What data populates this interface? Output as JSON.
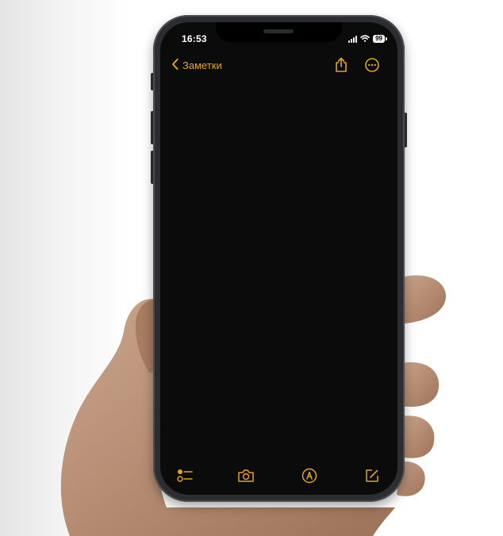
{
  "status_bar": {
    "time": "16:53",
    "battery": "99"
  },
  "navigation": {
    "back_label": "Заметки",
    "back_icon": "chevron-left-icon",
    "share_icon": "share-icon",
    "more_icon": "ellipsis-circle-icon"
  },
  "toolbar": {
    "icons": [
      "checklist-icon",
      "camera-icon",
      "markup-pen-icon",
      "compose-icon"
    ]
  },
  "colors": {
    "accent": "#e3a51c",
    "screen_background": "#0b0b0b",
    "phone_frame": "#2b2d31"
  }
}
